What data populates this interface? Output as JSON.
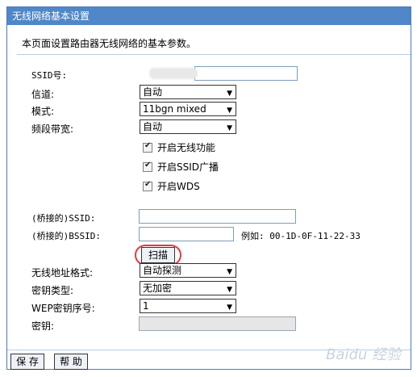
{
  "panel": {
    "title": "无线网络基本设置",
    "description": "本页面设置路由器无线网络的基本参数。"
  },
  "fields": {
    "ssid_label": "SSID号:",
    "channel_label": "信道:",
    "channel_value": "自动",
    "mode_label": "模式:",
    "mode_value": "11bgn mixed",
    "bandwidth_label": "频段带宽:",
    "bandwidth_value": "自动",
    "enable_wireless": "开启无线功能",
    "enable_ssid_broadcast": "开启SSID广播",
    "enable_wds": "开启WDS",
    "bridge_ssid_label": "(桥接的)SSID:",
    "bridge_bssid_label": "(桥接的)BSSID:",
    "bssid_example": "例如: 00-1D-0F-11-22-33",
    "scan_button": "扫描",
    "wireless_addr_format_label": "无线地址格式:",
    "wireless_addr_format_value": "自动探测",
    "key_type_label": "密钥类型:",
    "key_type_value": "无加密",
    "wep_index_label": "WEP密钥序号:",
    "wep_index_value": "1",
    "key_label": "密钥:"
  },
  "footer": {
    "save_button": "保 存",
    "help_button": "帮 助"
  },
  "watermark": "Baidu 经验"
}
